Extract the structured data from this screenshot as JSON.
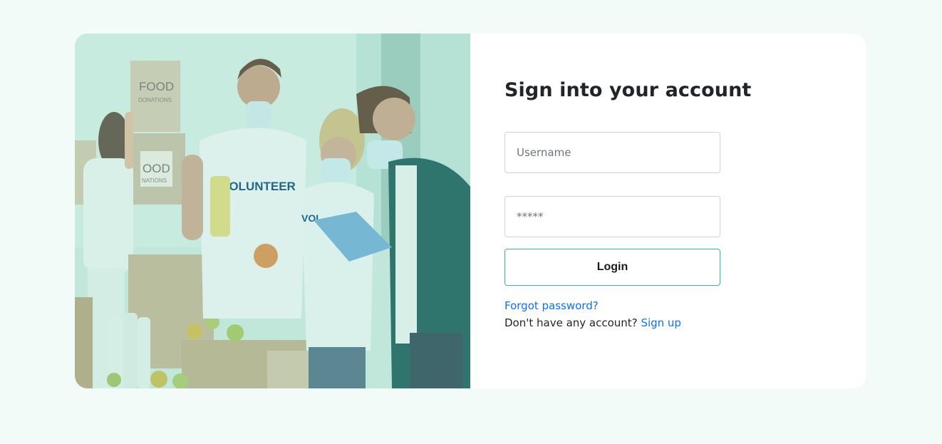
{
  "login": {
    "title": "Sign into your account",
    "username_placeholder": "Username",
    "password_placeholder": "*****",
    "login_label": "Login",
    "forgot_label": "Forgot password?",
    "no_account_text": "Don't have any account?",
    "signup_label": "Sign up"
  },
  "photo": {
    "box1_line1": "FOOD",
    "box1_line2": "DONATIONS",
    "box2_line1": "OOD",
    "box2_line2": "NATIONS",
    "shirt_text": "VOLUNTEER",
    "shirt_text_partial": "VOL"
  },
  "colors": {
    "page_background": "#f3fbf8",
    "accent_border": "#3cb88a",
    "link": "#0d6efd",
    "heading": "#212529"
  }
}
